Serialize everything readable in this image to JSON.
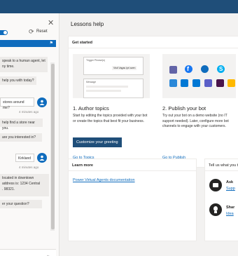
{
  "chat": {
    "reset_label": "Reset",
    "messages": [
      {
        "from": "bot",
        "text": "speak to a human agent, let\nny time."
      },
      {
        "from": "bot",
        "text": "help you with today?"
      },
      {
        "from": "user",
        "text": "stores around me?",
        "time": "4 minutes ago"
      },
      {
        "from": "bot",
        "text": "help find a store near you."
      },
      {
        "from": "bot",
        "text": "are you interested in?"
      },
      {
        "from": "user",
        "text": "Kirkland",
        "time": "4 minutes ago"
      },
      {
        "from": "bot",
        "text": "located in downtown\naddress is: 1234 Central\n. 98321."
      },
      {
        "from": "bot",
        "text": "er your question?"
      }
    ]
  },
  "main": {
    "title": "Lessons help",
    "get_started": {
      "heading": "Get started",
      "author": {
        "mock_trigger": "Trigger Phrase(s)",
        "mock_user": "Visit Vagas ipri aven",
        "mock_message": "Message",
        "title": "1. Author topics",
        "text": "Start by editing the topics provided with your bot or create the topics that best fit your business.",
        "button": "Customize your greeting",
        "link": "Go to Topics"
      },
      "publish": {
        "title": "2. Publish your bot",
        "text": "Try out your bot on a demo website (no IT support needed). Later, configure more bot channels to engage with your customers.",
        "link": "Go to Publish"
      }
    },
    "learn_more": {
      "heading": "Learn more",
      "link": "Power Virtual Agents documentation"
    },
    "feedback": {
      "heading": "Tell us what you t",
      "ask_title": "Ask",
      "ask_link": "Supp",
      "share_title": "Shar",
      "share_link": "Idea"
    }
  },
  "colors": {
    "accent": "#1f4e79",
    "brand_blue": "#0f6cbd",
    "bg": "#f3f2f1"
  }
}
